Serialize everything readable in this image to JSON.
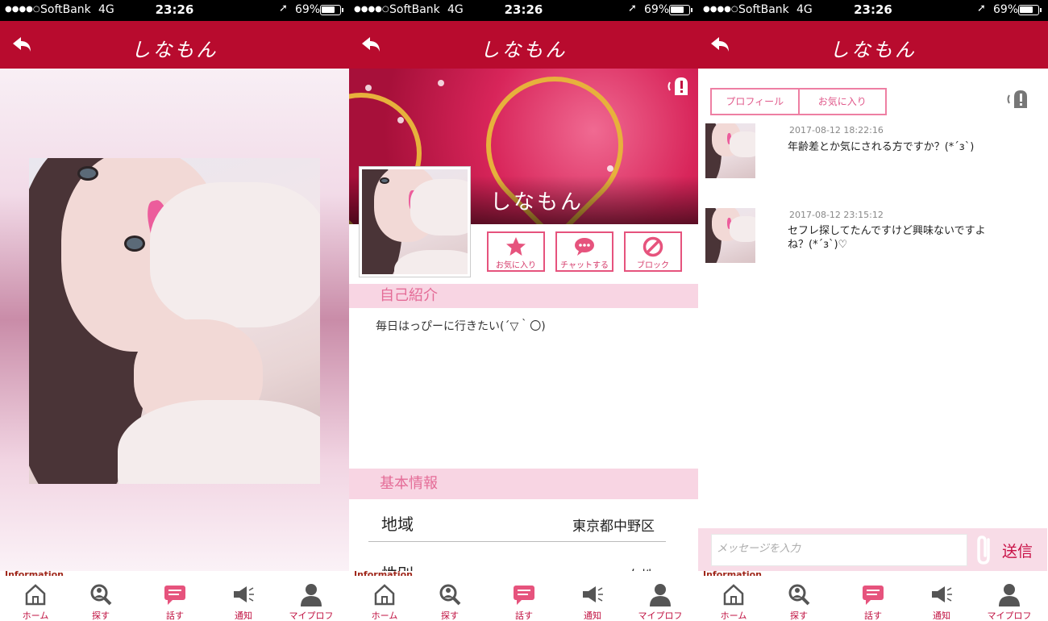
{
  "status_bar": {
    "signal_dots": "●●●●○",
    "carrier": "SoftBank",
    "network": "4G",
    "time": "23:26",
    "battery": "69%"
  },
  "header": {
    "title": "しなもん"
  },
  "screen2": {
    "cover_name": "しなもん",
    "actions": {
      "favorite": "お気に入り",
      "chat": "チャットする",
      "block": "ブロック"
    },
    "intro": {
      "header": "自己紹介",
      "text": "毎日はっぴーに行きたい(´▽｀〇)"
    },
    "basic": {
      "header": "基本情報",
      "rows": [
        {
          "key": "地域",
          "value": "東京都中野区"
        },
        {
          "key": "性別",
          "value": "女性"
        }
      ]
    }
  },
  "screen3": {
    "tabs": [
      "プロフィール",
      "お気に入り"
    ],
    "messages": [
      {
        "time": "2017-08-12 18:22:16",
        "text": "年齢差とか気にされる方ですか？(*´з`)"
      },
      {
        "time": "2017-08-12 23:15:12",
        "text": "セフレ探してたんですけど興味ないですよね？(*´з`)♡"
      }
    ],
    "composer": {
      "placeholder": "メッセージを入力",
      "send": "送信"
    }
  },
  "tabbar": {
    "info_label": "Information",
    "items": [
      {
        "label": "ホーム",
        "icon": "home-icon"
      },
      {
        "label": "探す",
        "icon": "search-icon"
      },
      {
        "label": "話す",
        "icon": "chat-icon"
      },
      {
        "label": "通知",
        "icon": "megaphone-icon"
      },
      {
        "label": "マイプロフ",
        "icon": "profile-icon"
      }
    ]
  },
  "colors": {
    "header": "#b80b2e",
    "accent_pink": "#e6537d",
    "section_bg": "#f8d5e3"
  }
}
